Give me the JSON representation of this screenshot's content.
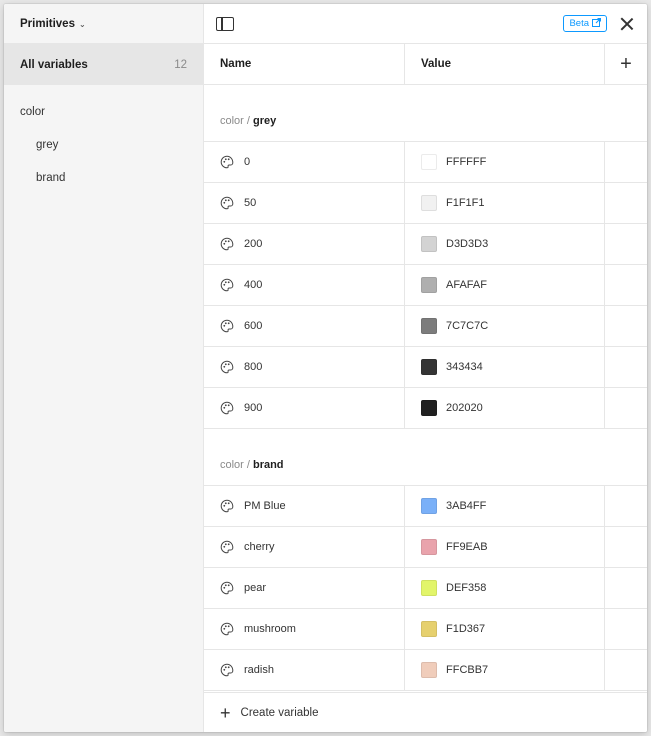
{
  "sidebar": {
    "collection": "Primitives",
    "all_variables_label": "All variables",
    "all_variables_count": "12",
    "groups": [
      {
        "label": "color",
        "child": false
      },
      {
        "label": "grey",
        "child": true
      },
      {
        "label": "brand",
        "child": true
      }
    ]
  },
  "topbar": {
    "beta_label": "Beta"
  },
  "table": {
    "col_name": "Name",
    "col_value": "Value",
    "add_column_icon": "plus-icon",
    "groups": [
      {
        "prefix": "color /",
        "name": "grey",
        "rows": [
          {
            "name": "0",
            "value": "FFFFFF",
            "color": "#FFFFFF"
          },
          {
            "name": "50",
            "value": "F1F1F1",
            "color": "#F1F1F1"
          },
          {
            "name": "200",
            "value": "D3D3D3",
            "color": "#D3D3D3"
          },
          {
            "name": "400",
            "value": "AFAFAF",
            "color": "#AFAFAF"
          },
          {
            "name": "600",
            "value": "7C7C7C",
            "color": "#7C7C7C"
          },
          {
            "name": "800",
            "value": "343434",
            "color": "#343434"
          },
          {
            "name": "900",
            "value": "202020",
            "color": "#202020"
          }
        ]
      },
      {
        "prefix": "color /",
        "name": "brand",
        "rows": [
          {
            "name": "PM Blue",
            "value": "3AB4FF",
            "color": "#7AB0F8"
          },
          {
            "name": "cherry",
            "value": "FF9EAB",
            "color": "#E9A3AC"
          },
          {
            "name": "pear",
            "value": "DEF358",
            "color": "#E2F56A"
          },
          {
            "name": "mushroom",
            "value": "F1D367",
            "color": "#E6D06E"
          },
          {
            "name": "radish",
            "value": "FFCBB7",
            "color": "#F0CDBB"
          }
        ]
      }
    ]
  },
  "footer": {
    "create_label": "Create variable"
  }
}
